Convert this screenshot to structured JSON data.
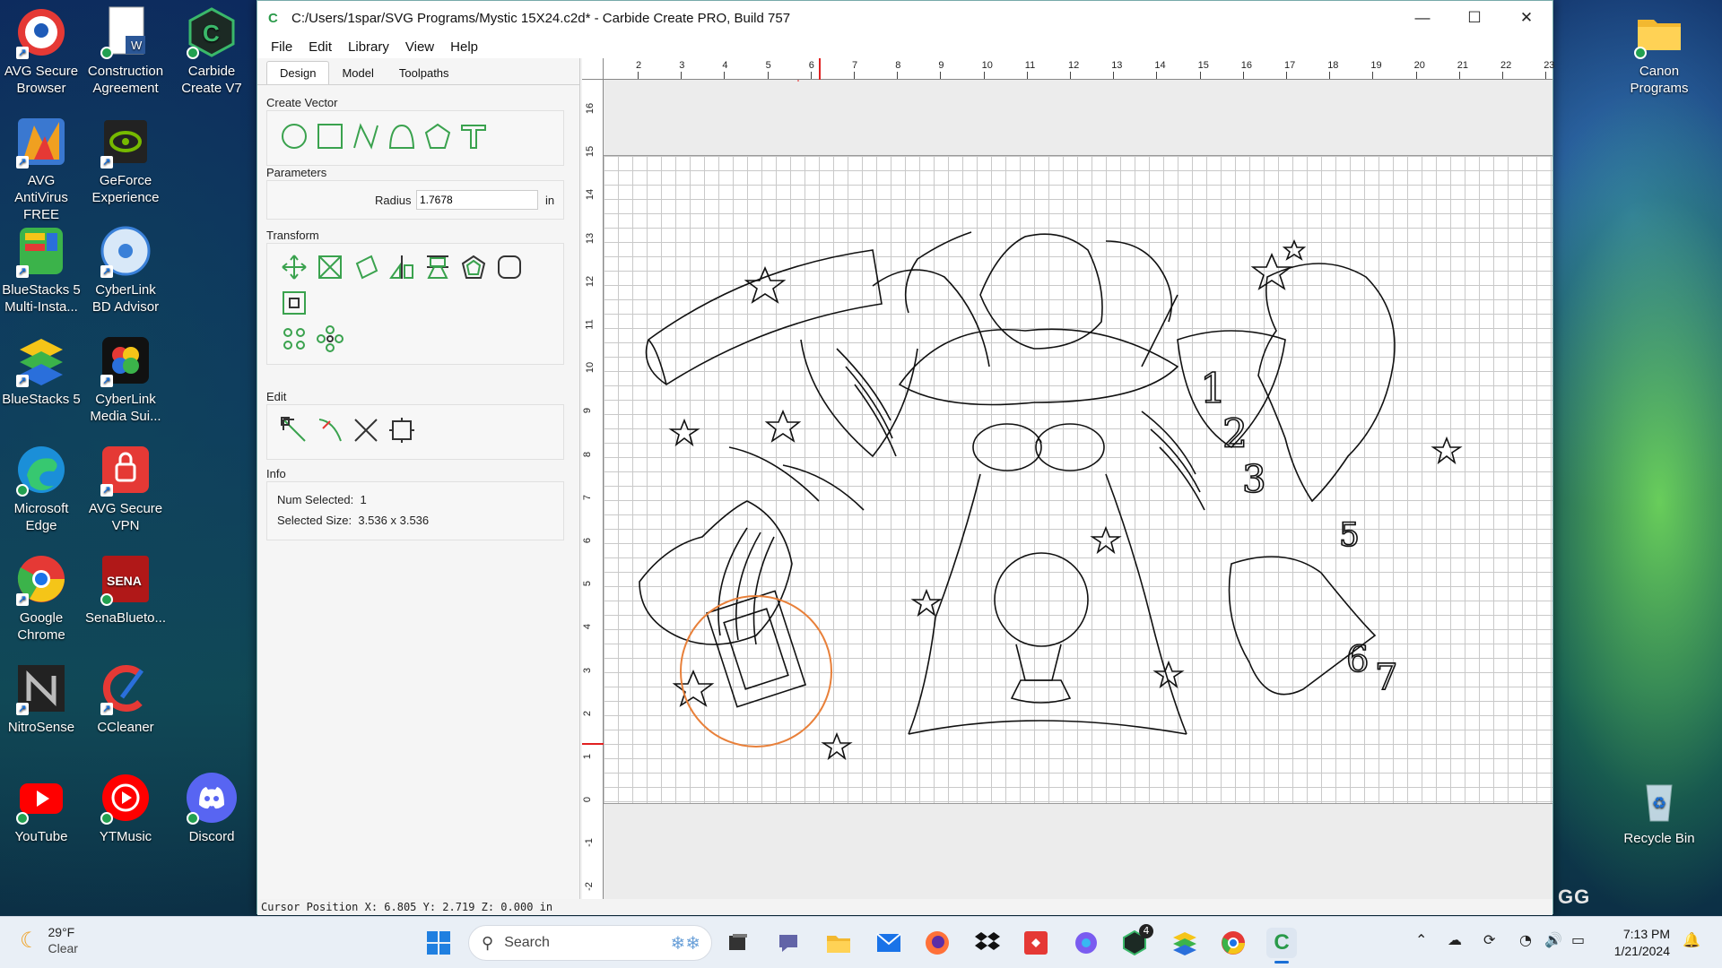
{
  "desktop": {
    "icons_left": [
      {
        "label": "AVG Secure Browser",
        "icon": "avg-browser-icon"
      },
      {
        "label": "Construction Agreement",
        "icon": "word-doc-icon"
      },
      {
        "label": "Carbide Create V7",
        "icon": "carbide-create-icon"
      },
      {
        "label": "AVG AntiVirus FREE",
        "icon": "avg-antivirus-icon"
      },
      {
        "label": "GeForce Experience",
        "icon": "geforce-icon"
      },
      {
        "label": "BlueStacks 5 Multi-Insta...",
        "icon": "bluestacks-multi-icon"
      },
      {
        "label": "CyberLink BD Advisor",
        "icon": "cyberlink-bd-icon"
      },
      {
        "label": "BlueStacks 5",
        "icon": "bluestacks-icon"
      },
      {
        "label": "CyberLink Media Sui...",
        "icon": "cyberlink-media-icon"
      },
      {
        "label": "Microsoft Edge",
        "icon": "edge-icon"
      },
      {
        "label": "AVG Secure VPN",
        "icon": "avg-vpn-icon"
      },
      {
        "label": "Google Chrome",
        "icon": "chrome-icon"
      },
      {
        "label": "SenaBlueto...",
        "icon": "sena-icon"
      },
      {
        "label": "NitroSense",
        "icon": "nitrosense-icon"
      },
      {
        "label": "CCleaner",
        "icon": "ccleaner-icon"
      },
      {
        "label": "YouTube",
        "icon": "youtube-icon"
      },
      {
        "label": "YTMusic",
        "icon": "ytmusic-icon"
      },
      {
        "label": "Discord",
        "icon": "discord-icon"
      }
    ],
    "icons_right": [
      {
        "label": "Canon Programs",
        "icon": "folder-icon"
      },
      {
        "label": "Recycle Bin",
        "icon": "recycle-bin-icon"
      }
    ],
    "watermark": "GG"
  },
  "window": {
    "title": "C:/Users/1spar/SVG Programs/Mystic 15X24.c2d* - Carbide Create PRO, Build 757",
    "menu": [
      "File",
      "Edit",
      "Library",
      "View",
      "Help"
    ]
  },
  "panel": {
    "tabs": [
      "Design",
      "Model",
      "Toolpaths"
    ],
    "active_tab": "Design",
    "create_vector": {
      "header": "Create Vector",
      "tools": [
        "circle-tool-icon",
        "rectangle-tool-icon",
        "polyline-tool-icon",
        "curve-tool-icon",
        "polygon-tool-icon",
        "text-tool-icon"
      ]
    },
    "parameters": {
      "header": "Parameters",
      "radius_label": "Radius",
      "radius_value": "1.7678",
      "unit": "in"
    },
    "transform": {
      "header": "Transform"
    },
    "edit": {
      "header": "Edit"
    },
    "info": {
      "header": "Info",
      "num_selected_label": "Num Selected:",
      "num_selected": "1",
      "selected_size_label": "Selected Size:",
      "selected_size": "3.536 x 3.536"
    }
  },
  "rulers": {
    "h_labels": [
      "2",
      "3",
      "4",
      "5",
      "6",
      "7",
      "8",
      "9",
      "10",
      "11",
      "12",
      "13",
      "14",
      "15",
      "16",
      "17",
      "18",
      "19",
      "20",
      "21",
      "22",
      "23"
    ],
    "v_labels": [
      "16",
      "15",
      "14",
      "13",
      "12",
      "11",
      "10",
      "9",
      "8",
      "7",
      "6",
      "5",
      "4",
      "3",
      "2",
      "1",
      "0",
      "-1",
      "-2"
    ]
  },
  "status": {
    "cursor": "Cursor Position X: 6.805 Y: 2.719 Z: 0.000 in"
  },
  "taskbar": {
    "weather_temp": "29°F",
    "weather_desc": "Clear",
    "search_placeholder": "Search",
    "time": "7:13 PM",
    "date": "1/21/2024",
    "badge_count": "4"
  },
  "colors": {
    "accent": "#2a9a4a",
    "selection": "#e8803a",
    "cursor_marker": "#e02020"
  }
}
